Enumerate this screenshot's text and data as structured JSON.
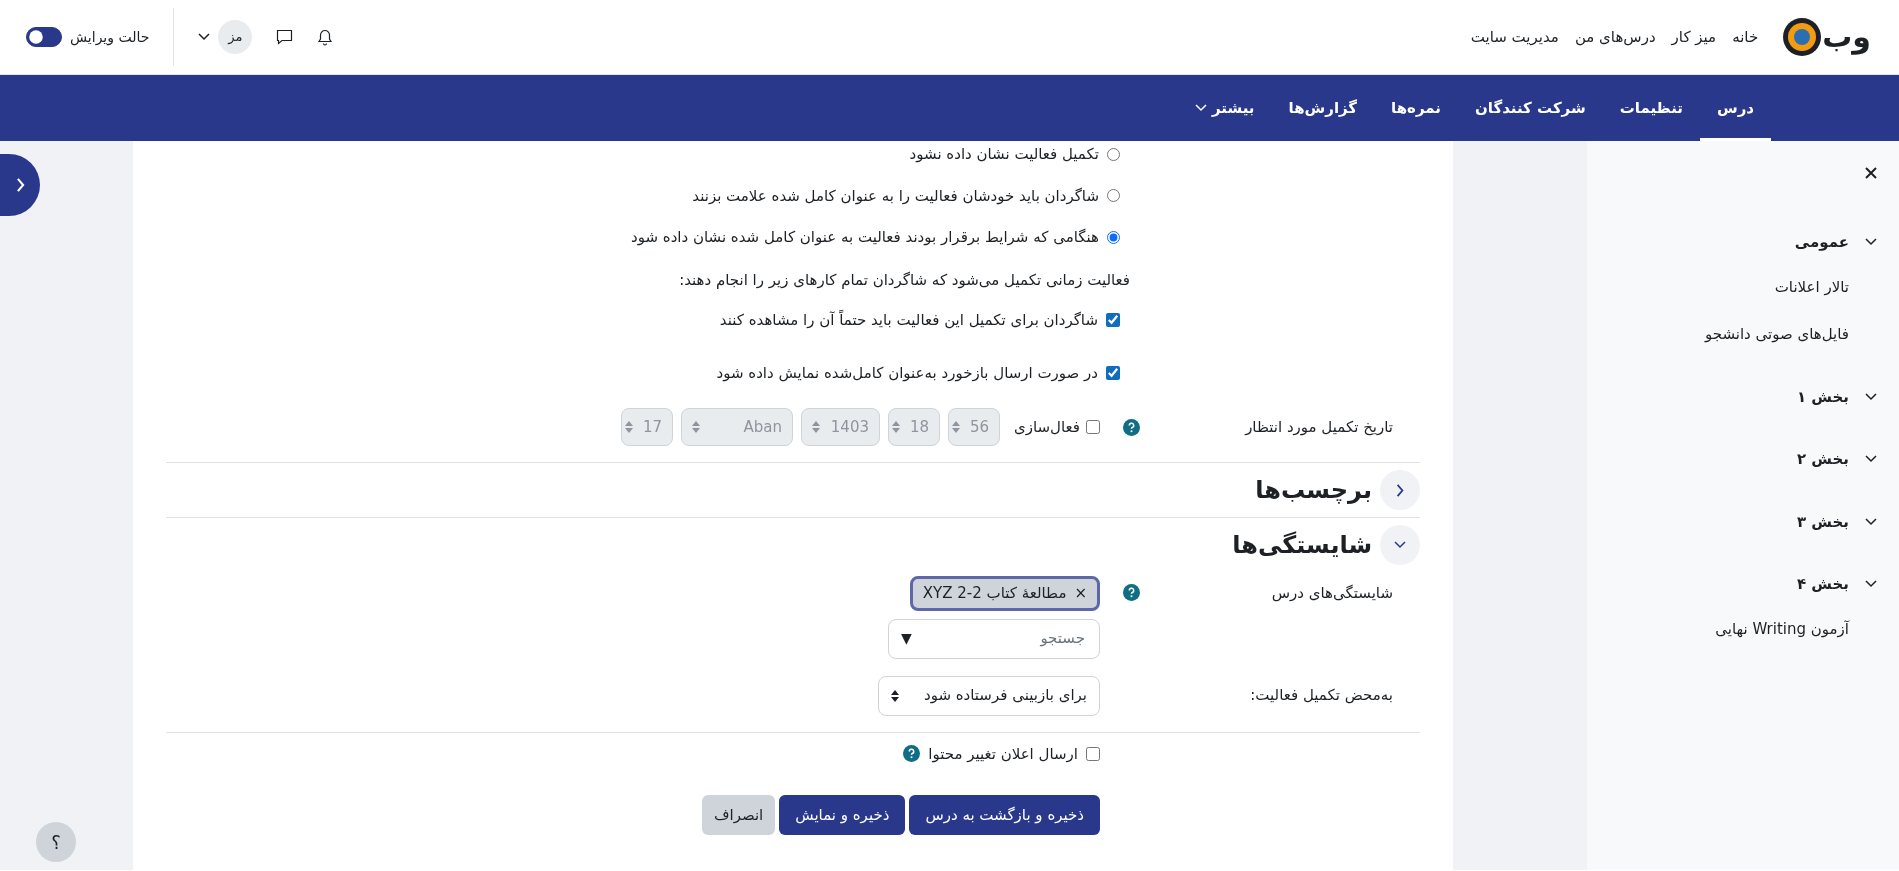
{
  "header": {
    "logo_text": "وب",
    "links": [
      {
        "label": "خانه"
      },
      {
        "label": "میز کار"
      },
      {
        "label": "درس‌های من"
      },
      {
        "label": "مدیریت سایت"
      }
    ],
    "user_initials": "مز",
    "edit_mode": {
      "label": "حالت ویرایش",
      "on": true
    }
  },
  "tabs": [
    {
      "label": "درس",
      "selected": true,
      "kind": "link"
    },
    {
      "label": "تنظیمات",
      "selected": false,
      "kind": "link"
    },
    {
      "label": "شرکت کنندگان",
      "selected": false,
      "kind": "link"
    },
    {
      "label": "نمره‌ها",
      "selected": false,
      "kind": "link"
    },
    {
      "label": "گزارش‌ها",
      "selected": false,
      "kind": "link"
    },
    {
      "label": "بیشتر",
      "selected": false,
      "kind": "menu"
    }
  ],
  "completion": {
    "options": [
      {
        "label": "تکمیل فعالیت نشان داده نشود",
        "selected": false
      },
      {
        "label": "شاگردان باید خودشان فعالیت را به عنوان کامل شده علامت بزنند",
        "selected": false
      },
      {
        "label": "هنگامی که شرایط برقرار بودند فعالیت به عنوان کامل شده نشان داده شود",
        "selected": true
      }
    ],
    "conditions_intro": "فعالیت زمانی تکمیل می‌شود که شاگردان تمام کارهای زیر را انجام دهند:",
    "conditions": [
      {
        "label": "شاگردان برای تکمیل این فعالیت باید حتماً آن را مشاهده کنند",
        "checked": true
      },
      {
        "label": "در صورت ارسال بازخورد به‌عنوان کامل‌شده نمایش داده شود",
        "checked": true
      }
    ]
  },
  "expected_date": {
    "label": "تاریخ تکمیل مورد انتظار",
    "enable_label": "فعال‌سازی",
    "enabled": false,
    "fields": [
      "56",
      "18",
      "1403",
      "Aban",
      "17"
    ]
  },
  "sections": [
    {
      "title": "برچسب‌ها",
      "expanded": false
    },
    {
      "title": "شایستگی‌ها",
      "expanded": true
    }
  ],
  "competencies": {
    "label": "شایستگی‌های درس",
    "tags": [
      {
        "label": "مطالعهٔ کتاب XYZ 2-2",
        "remove": "×"
      }
    ],
    "search": {
      "placeholder": "جستجو",
      "arrow": "▼"
    }
  },
  "upon_completion": {
    "label": "به‌محض تکمیل فعالیت:",
    "value": "برای بازبینی فرستاده شود"
  },
  "notify": {
    "label": "ارسال اعلان تغییر محتوا",
    "checked": false
  },
  "buttons": [
    {
      "label": "ذخیره و بازگشت به درس",
      "kind": "primary"
    },
    {
      "label": "ذخیره و نمایش",
      "kind": "primary"
    },
    {
      "label": "انصراف",
      "kind": "secondary"
    }
  ],
  "drawer": {
    "items": [
      {
        "title": "عمومی",
        "expanded": true,
        "children": [
          {
            "title": "تالار اعلانات"
          },
          {
            "title": "فایل‌های صوتی دانشجو"
          }
        ]
      },
      {
        "title": "بخش ۱",
        "expanded": true
      },
      {
        "title": "بخش ۲",
        "expanded": true
      },
      {
        "title": "بخش ۳",
        "expanded": true
      },
      {
        "title": "بخش ۴",
        "expanded": true,
        "children": [
          {
            "title": "آزمون Writing نهایی"
          }
        ]
      }
    ]
  },
  "help_button": "؟"
}
